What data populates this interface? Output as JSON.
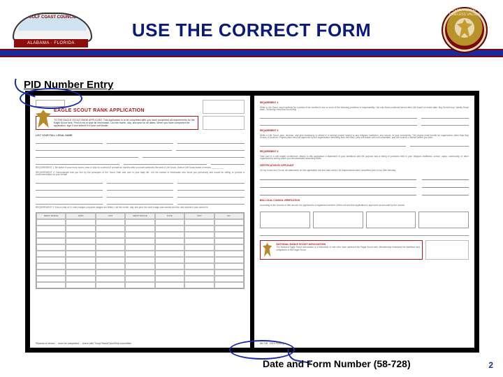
{
  "header": {
    "title": "USE THE CORRECT FORM",
    "left_patch_label": "GULF COAST COUNCIL",
    "left_patch_band": "ALABAMA · FLORIDA",
    "right_patch_ring": "ON MY HONOR · TIMELESS VALUES"
  },
  "annotations": {
    "pid_label": "PID Number Entry",
    "bottom_label": "Date and Form Number (58-728)"
  },
  "page1": {
    "heading": "EAGLE SCOUT RANK APPLICATION",
    "redbox": "TO THE EAGLE SCOUT RANK APPLICANT. This application is to be completed after you have completed all requirements for the Eagle Scout rank. Print in ink or type all information. List the month, day, and year for all dates. When you have completed the application, sign it and submit it to your unit leader.",
    "section_label": "LIST YOUR FULL LEGAL NAME",
    "grid_headers": [
      "MERIT BADGE",
      "DATE",
      "UNIT",
      "MERIT BADGE",
      "DATE",
      "UNIT",
      "NO."
    ],
    "footer": "*Boards of review ... must be completed ... check with Troop/Team/Crew/Ship committee."
  },
  "page2": {
    "req4": "REQUIREMENT 4",
    "req5": "REQUIREMENT 5",
    "req6": "REQUIREMENT 6",
    "cert": "CERTIFICATION BY APPLICANT",
    "bsa_action": "BSA LOCAL COUNCIL VERIFICATION",
    "nesa_box_title": "NATIONAL EAGLE SCOUT ASSOCIATION",
    "footer_id": "58-728",
    "footer_date": "2019 Printing"
  },
  "slide_number": "2"
}
